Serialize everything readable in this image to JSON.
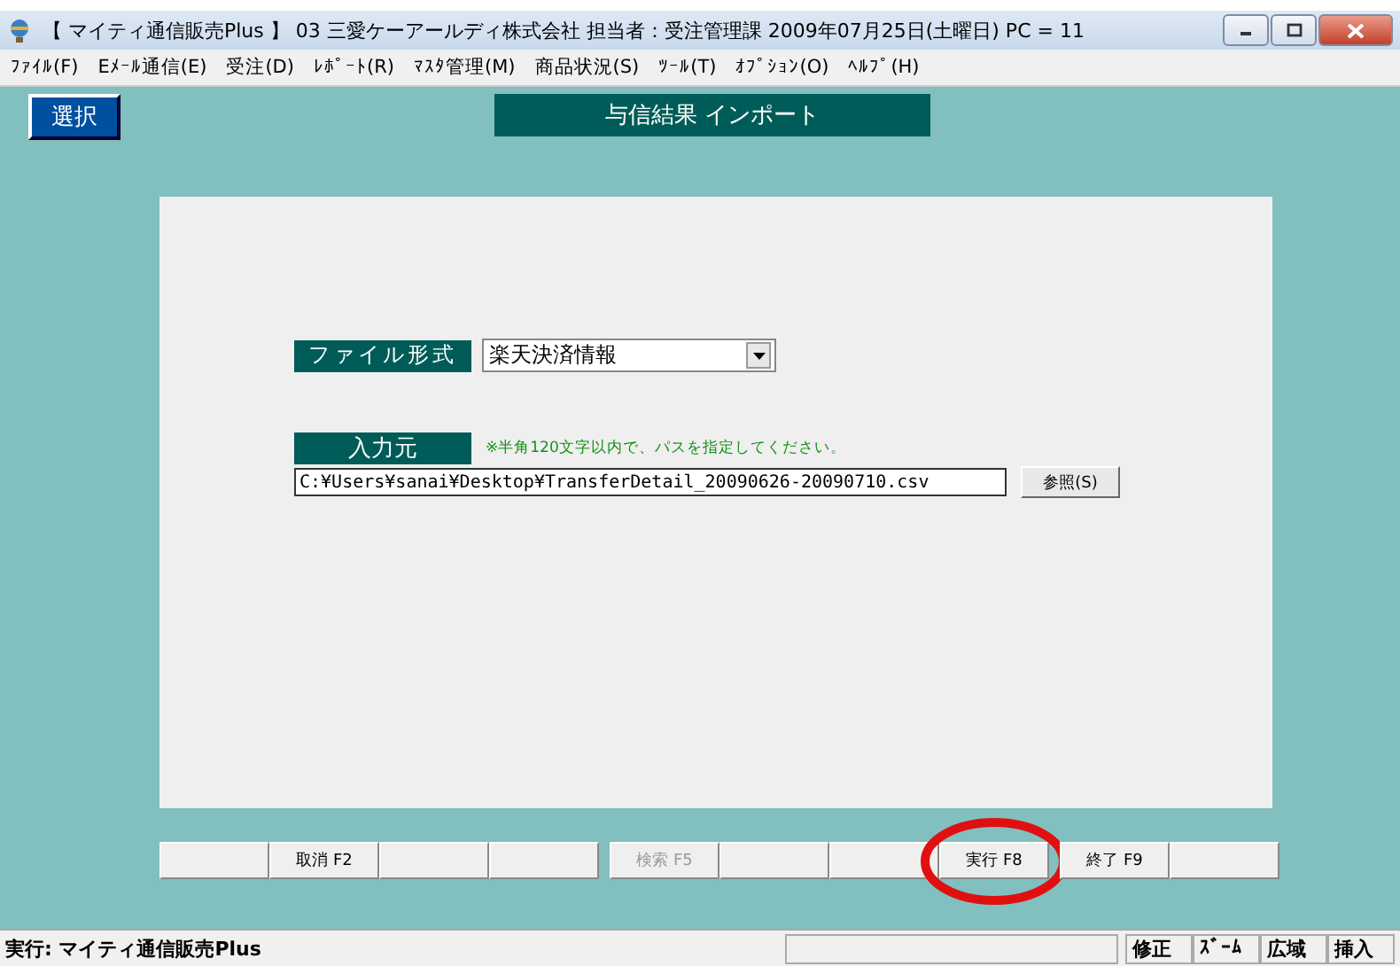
{
  "window": {
    "title": "【 マイティ通信販売Plus 】 03 三愛ケーアールディ株式会社  担当者：受注管理課   2009年07月25日(土曜日)  PC = 11"
  },
  "menu": [
    {
      "label": "ﾌｧｲﾙ(F)"
    },
    {
      "label": "Eﾒｰﾙ通信(E)"
    },
    {
      "label": "受注(D)"
    },
    {
      "label": "ﾚﾎﾟｰﾄ(R)"
    },
    {
      "label": "ﾏｽﾀ管理(M)"
    },
    {
      "label": "商品状況(S)"
    },
    {
      "label": "ﾂｰﾙ(T)"
    },
    {
      "label": "ｵﾌﾟｼｮﾝ(O)"
    },
    {
      "label": "ﾍﾙﾌﾟ(H)"
    }
  ],
  "select_button": "選択",
  "screen_title": "与信結果 インポート",
  "file_format": {
    "label": "ファイル形式",
    "value": "楽天決済情報"
  },
  "input_source": {
    "label": "入力元",
    "hint": "※半角120文字以内で、パスを指定してください。",
    "value": "C:¥Users¥sanai¥Desktop¥TransferDetail_20090626-20090710.csv",
    "browse": "参照(S)"
  },
  "function_keys": [
    [
      {
        "kind": "blank"
      },
      {
        "kind": "key",
        "label": "取消 F2",
        "disabled": false
      },
      {
        "kind": "blank"
      },
      {
        "kind": "blank"
      }
    ],
    [
      {
        "kind": "key",
        "label": "検索 F5",
        "disabled": true
      },
      {
        "kind": "blank"
      },
      {
        "kind": "blank"
      },
      {
        "kind": "key",
        "label": "実行 F8",
        "disabled": false,
        "circled": true
      }
    ],
    [
      {
        "kind": "key",
        "label": "終了 F9",
        "disabled": false
      },
      {
        "kind": "blank"
      }
    ]
  ],
  "status_bar": {
    "message": "実行: マイティ通信販売Plus",
    "cells": [
      "修正",
      "ｽﾞｰﾑ",
      "広域",
      "挿入"
    ]
  }
}
